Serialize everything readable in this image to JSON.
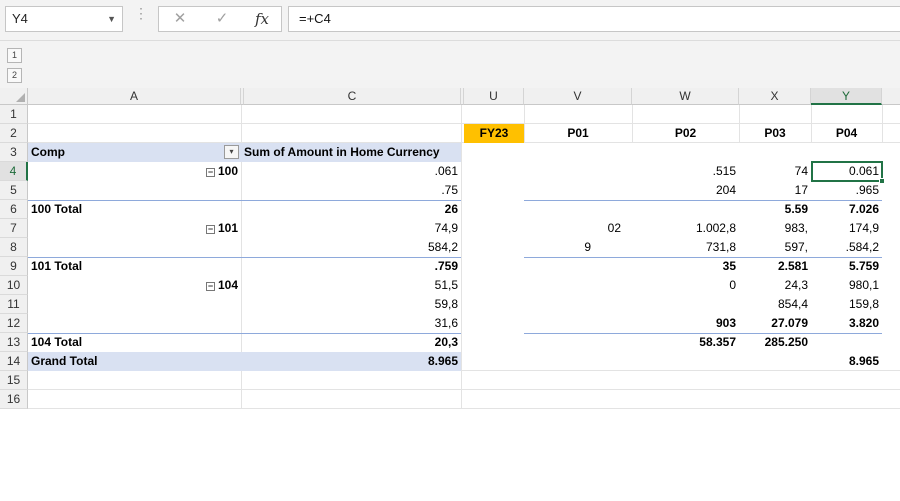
{
  "namebox": {
    "value": "Y4"
  },
  "formula": {
    "value": "=+C4"
  },
  "outline_levels": [
    "1",
    "2"
  ],
  "columns": [
    "A",
    "C",
    "U",
    "V",
    "W",
    "X",
    "Y"
  ],
  "rows": [
    "1",
    "2",
    "3",
    "4",
    "5",
    "6",
    "7",
    "8",
    "9",
    "10",
    "11",
    "12",
    "13",
    "14",
    "15",
    "16"
  ],
  "pivot": {
    "header_row": {
      "col_a": "Comp",
      "col_b": "Sum of Amount in Home Currency"
    },
    "groups": [
      "100",
      "101",
      "104"
    ],
    "totals": [
      "100 Total",
      "101 Total",
      "104 Total"
    ],
    "grand_total": "Grand Total",
    "c_values": [
      ".061",
      ".75",
      "26",
      "74,9",
      "584,2",
      ".759",
      "51,5",
      "59,8",
      "31,6",
      "20,3",
      "8.965"
    ]
  },
  "right_headers": {
    "fy": "FY23",
    "p01": "P01",
    "p02": "P02",
    "p03": "P03",
    "p04": "P04"
  },
  "colV": [
    "02",
    "9"
  ],
  "colW": [
    ".515",
    "204",
    "1.002,8",
    "731,8",
    "35",
    "0",
    "903",
    "58.357"
  ],
  "colX": [
    "74",
    "17",
    "5.59",
    "983,",
    "597,",
    "2.581",
    "24,3",
    "854,4",
    "27.079",
    "285.250"
  ],
  "colY": [
    "0.061",
    ".965",
    "7.026",
    "174,9",
    ".584,2",
    "5.759",
    "980,1",
    "159,8",
    "3.820",
    "8.965"
  ],
  "icons": {
    "cancel": "✕",
    "enter": "✓",
    "fx": "fx",
    "expand": "−",
    "filter": "▾"
  }
}
